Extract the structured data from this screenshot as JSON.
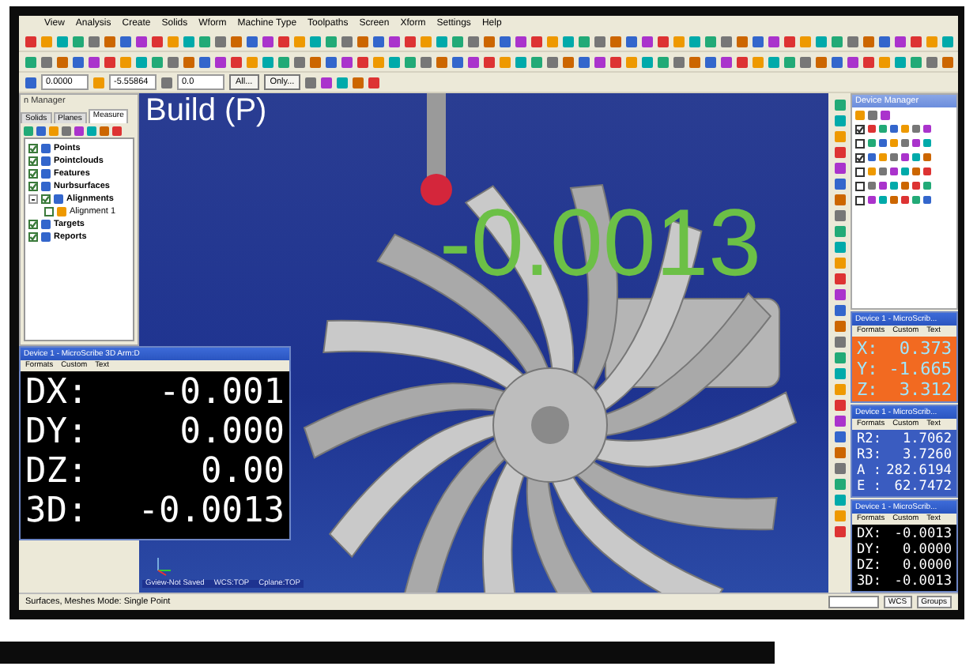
{
  "menu_bar": [
    "View",
    "Analysis",
    "Create",
    "Solids",
    "Wform",
    "Machine Type",
    "Toolpaths",
    "Screen",
    "Xform",
    "Settings",
    "Help"
  ],
  "toolbar": {
    "fields": [
      "0.0000",
      "-5.55864",
      "0.0"
    ],
    "buttons": [
      "All...",
      "Only..."
    ]
  },
  "manager": {
    "title": "n Manager",
    "tabs": [
      {
        "label": "Solids",
        "selected": false
      },
      {
        "label": "Planes",
        "selected": false
      },
      {
        "label": "Measure",
        "selected": true
      }
    ],
    "tree": [
      {
        "label": "Points",
        "checked": true
      },
      {
        "label": "Pointclouds",
        "checked": true
      },
      {
        "label": "Features",
        "checked": true
      },
      {
        "label": "Nurbsurfaces",
        "checked": true
      },
      {
        "label": "Alignments",
        "checked": true,
        "expanded": true,
        "children": [
          {
            "label": "Alignment 1",
            "checked": false
          }
        ]
      },
      {
        "label": "Targets",
        "checked": true
      },
      {
        "label": "Reports",
        "checked": true
      }
    ]
  },
  "floating_dro": {
    "title": "Device 1 - MicroScribe 3D Arm:D",
    "menu": [
      "Formats",
      "Custom",
      "Text"
    ],
    "kind": "black",
    "rows": [
      {
        "label": "DX:",
        "value": "-0.001"
      },
      {
        "label": "DY:",
        "value": "0.000"
      },
      {
        "label": "DZ:",
        "value": "0.00"
      },
      {
        "label": "3D:",
        "value": "-0.0013"
      }
    ]
  },
  "viewport": {
    "title": "Build (P)",
    "readout": "-0.0013",
    "info": [
      "Gview-Not Saved",
      "WCS:TOP",
      "Cplane:TOP"
    ]
  },
  "device_manager": {
    "title": "Device Manager",
    "rows": [
      {
        "checked": true
      },
      {
        "checked": false
      },
      {
        "checked": true
      },
      {
        "checked": false
      },
      {
        "checked": false
      },
      {
        "checked": false
      }
    ]
  },
  "dro_panels": [
    {
      "title": "Device 1 - MicroScrib...",
      "menu": [
        "Formats",
        "Custom",
        "Text"
      ],
      "kind": "orange",
      "rows": [
        {
          "label": "X:",
          "value": "0.373"
        },
        {
          "label": "Y:",
          "value": "-1.665"
        },
        {
          "label": "Z:",
          "value": "3.312"
        }
      ]
    },
    {
      "title": "Device 1 - MicroScrib...",
      "menu": [
        "Formats",
        "Custom",
        "Text"
      ],
      "kind": "blue",
      "rows": [
        {
          "label": "R2:",
          "value": "1.7062"
        },
        {
          "label": "R3:",
          "value": "3.7260"
        },
        {
          "label": "A :",
          "value": "282.6194"
        },
        {
          "label": "E :",
          "value": "62.7472"
        }
      ]
    },
    {
      "title": "Device 1 - MicroScrib...",
      "menu": [
        "Formats",
        "Custom",
        "Text"
      ],
      "kind": "black",
      "rows": [
        {
          "label": "DX:",
          "value": "-0.0013"
        },
        {
          "label": "DY:",
          "value": "0.0000"
        },
        {
          "label": "DZ:",
          "value": "0.0000"
        },
        {
          "label": "3D:",
          "value": "-0.0013"
        }
      ]
    }
  ],
  "status_bar": {
    "text": "Surfaces, Meshes Mode: Single Point",
    "controls": [
      "WCS",
      "Groups"
    ]
  }
}
